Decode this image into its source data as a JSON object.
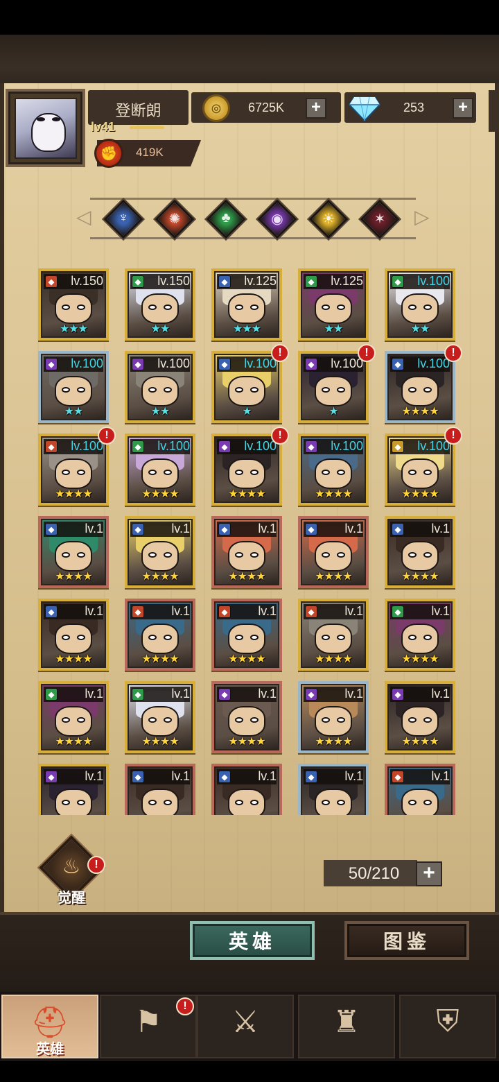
{
  "player": {
    "name": "登断朗",
    "level": "lv41",
    "power": "419K"
  },
  "currency": {
    "gold": "6725K",
    "gems": "253"
  },
  "filters": [
    {
      "name": "element-1",
      "color": "#3a62b0",
      "icon": "rune-icon"
    },
    {
      "name": "element-2",
      "color": "#c2472a",
      "icon": "sun-gear-icon"
    },
    {
      "name": "element-3",
      "color": "#2f9a4a",
      "icon": "clover-icon"
    },
    {
      "name": "element-4",
      "color": "#7a3ab0",
      "icon": "eye-orb-icon"
    },
    {
      "name": "element-5",
      "color": "#e0b22a",
      "icon": "sun-eye-icon"
    },
    {
      "name": "element-6",
      "color": "#6a1f2a",
      "icon": "dark-sigil-icon"
    }
  ],
  "heroes": [
    {
      "level": "lv.150",
      "stars": 3,
      "star_color": "teal",
      "tier": "gold",
      "level_color": "white",
      "class_color": "#c2472a",
      "hair": "#3a3028",
      "alert": false
    },
    {
      "level": "lv.150",
      "stars": 2,
      "star_color": "teal",
      "tier": "gold",
      "level_color": "white",
      "class_color": "#2f9a4a",
      "hair": "#dfe2ee",
      "alert": false
    },
    {
      "level": "lv.125",
      "stars": 3,
      "star_color": "teal",
      "tier": "gold",
      "level_color": "white",
      "class_color": "#3a62b0",
      "hair": "#e6d9c2",
      "alert": false
    },
    {
      "level": "lv.125",
      "stars": 2,
      "star_color": "teal",
      "tier": "gold",
      "level_color": "white",
      "class_color": "#2f9a4a",
      "hair": "#7a3a6a",
      "alert": false
    },
    {
      "level": "lv.100",
      "stars": 2,
      "star_color": "teal",
      "tier": "gold",
      "level_color": "cyan",
      "class_color": "#2f9a4a",
      "hair": "#e8e8ee",
      "alert": false
    },
    {
      "level": "lv.100",
      "stars": 2,
      "star_color": "teal",
      "tier": "blue",
      "level_color": "cyan",
      "class_color": "#7a3ab0",
      "hair": "#6e6a66",
      "alert": false
    },
    {
      "level": "lv.100",
      "stars": 2,
      "star_color": "teal",
      "tier": "gold",
      "level_color": "white",
      "class_color": "#7a3ab0",
      "hair": "#8a8478",
      "alert": false
    },
    {
      "level": "lv.100",
      "stars": 1,
      "star_color": "teal",
      "tier": "gold",
      "level_color": "cyan",
      "class_color": "#3a62b0",
      "hair": "#e9cf6a",
      "alert": true
    },
    {
      "level": "lv.100",
      "stars": 1,
      "star_color": "teal",
      "tier": "gold",
      "level_color": "white",
      "class_color": "#7a3ab0",
      "hair": "#2a2230",
      "alert": true
    },
    {
      "level": "lv.100",
      "stars": 4,
      "star_color": "gold",
      "tier": "blue",
      "level_color": "cyan",
      "class_color": "#3a62b0",
      "hair": "#2a2424",
      "alert": true
    },
    {
      "level": "lv.100",
      "stars": 4,
      "star_color": "gold",
      "tier": "gold",
      "level_color": "cyan",
      "class_color": "#c2472a",
      "hair": "#9a9288",
      "alert": true
    },
    {
      "level": "lv.100",
      "stars": 4,
      "star_color": "gold",
      "tier": "gold",
      "level_color": "cyan",
      "class_color": "#2f9a4a",
      "hair": "#c8a8d8",
      "alert": false
    },
    {
      "level": "lv.100",
      "stars": 4,
      "star_color": "gold",
      "tier": "gold",
      "level_color": "cyan",
      "class_color": "#7a3ab0",
      "hair": "#2c2424",
      "alert": true
    },
    {
      "level": "lv.100",
      "stars": 4,
      "star_color": "gold",
      "tier": "gold",
      "level_color": "cyan",
      "class_color": "#7a3ab0",
      "hair": "#4a6a8a",
      "alert": false
    },
    {
      "level": "lv.100",
      "stars": 4,
      "star_color": "gold",
      "tier": "gold",
      "level_color": "cyan",
      "class_color": "#c89a2a",
      "hair": "#efd98a",
      "alert": true
    },
    {
      "level": "lv.1",
      "stars": 4,
      "star_color": "gold",
      "tier": "red",
      "level_color": "white",
      "class_color": "#3a62b0",
      "hair": "#2f8a6a",
      "alert": false
    },
    {
      "level": "lv.1",
      "stars": 4,
      "star_color": "gold",
      "tier": "gold",
      "level_color": "white",
      "class_color": "#3a62b0",
      "hair": "#e9cf6a",
      "alert": false
    },
    {
      "level": "lv.1",
      "stars": 4,
      "star_color": "gold",
      "tier": "red",
      "level_color": "white",
      "class_color": "#3a62b0",
      "hair": "#d46a4a",
      "alert": false
    },
    {
      "level": "lv.1",
      "stars": 4,
      "star_color": "gold",
      "tier": "red",
      "level_color": "white",
      "class_color": "#3a62b0",
      "hair": "#d46a4a",
      "alert": false
    },
    {
      "level": "lv.1",
      "stars": 4,
      "star_color": "gold",
      "tier": "gold",
      "level_color": "white",
      "class_color": "#3a62b0",
      "hair": "#3a2a24",
      "alert": false
    },
    {
      "level": "lv.1",
      "stars": 4,
      "star_color": "gold",
      "tier": "gold",
      "level_color": "white",
      "class_color": "#3a62b0",
      "hair": "#3a2a24",
      "alert": false
    },
    {
      "level": "lv.1",
      "stars": 4,
      "star_color": "gold",
      "tier": "red",
      "level_color": "white",
      "class_color": "#c2472a",
      "hair": "#3a6a8a",
      "alert": false
    },
    {
      "level": "lv.1",
      "stars": 4,
      "star_color": "gold",
      "tier": "red",
      "level_color": "white",
      "class_color": "#c2472a",
      "hair": "#3a6a8a",
      "alert": false
    },
    {
      "level": "lv.1",
      "stars": 4,
      "star_color": "gold",
      "tier": "gold",
      "level_color": "white",
      "class_color": "#c2472a",
      "hair": "#8a8478",
      "alert": false
    },
    {
      "level": "lv.1",
      "stars": 4,
      "star_color": "gold",
      "tier": "gold",
      "level_color": "white",
      "class_color": "#2f9a4a",
      "hair": "#7a3a6a",
      "alert": false
    },
    {
      "level": "lv.1",
      "stars": 4,
      "star_color": "gold",
      "tier": "gold",
      "level_color": "white",
      "class_color": "#2f9a4a",
      "hair": "#7a3a6a",
      "alert": false
    },
    {
      "level": "lv.1",
      "stars": 4,
      "star_color": "gold",
      "tier": "gold",
      "level_color": "white",
      "class_color": "#2f9a4a",
      "hair": "#dfe2ee",
      "alert": false
    },
    {
      "level": "lv.1",
      "stars": 4,
      "star_color": "gold",
      "tier": "red",
      "level_color": "white",
      "class_color": "#7a3ab0",
      "hair": "#6a5a50",
      "alert": false
    },
    {
      "level": "lv.1",
      "stars": 4,
      "star_color": "gold",
      "tier": "blue",
      "level_color": "white",
      "class_color": "#7a3ab0",
      "hair": "#b88a5a",
      "alert": false
    },
    {
      "level": "lv.1",
      "stars": 4,
      "star_color": "gold",
      "tier": "gold",
      "level_color": "white",
      "class_color": "#7a3ab0",
      "hair": "#2c2424",
      "alert": false
    },
    {
      "level": "lv.1",
      "stars": 0,
      "star_color": "gold",
      "tier": "gold",
      "level_color": "white",
      "class_color": "#7a3ab0",
      "hair": "#2a2230",
      "alert": false
    },
    {
      "level": "lv.1",
      "stars": 0,
      "star_color": "gold",
      "tier": "red",
      "level_color": "white",
      "class_color": "#3a62b0",
      "hair": "#3a2a24",
      "alert": false
    },
    {
      "level": "lv.1",
      "stars": 0,
      "star_color": "gold",
      "tier": "red",
      "level_color": "white",
      "class_color": "#3a62b0",
      "hair": "#3a2a24",
      "alert": false
    },
    {
      "level": "lv.1",
      "stars": 0,
      "star_color": "gold",
      "tier": "blue",
      "level_color": "white",
      "class_color": "#3a62b0",
      "hair": "#2a2424",
      "alert": false
    },
    {
      "level": "lv.1",
      "stars": 0,
      "star_color": "gold",
      "tier": "red",
      "level_color": "white",
      "class_color": "#c2472a",
      "hair": "#3a6a8a",
      "alert": false
    }
  ],
  "awaken": {
    "label": "觉醒"
  },
  "roster": {
    "capacity": "50/210"
  },
  "tabs": {
    "heroes": "英雄",
    "codex": "图鉴"
  },
  "nav": [
    {
      "name": "heroes",
      "label": "英雄",
      "icon": "knight-helmet-icon",
      "active": true,
      "alert": false
    },
    {
      "name": "adventure",
      "label": "",
      "icon": "flag-wheel-icon",
      "active": false,
      "alert": true
    },
    {
      "name": "battle",
      "label": "",
      "icon": "crossed-swords-icon",
      "active": false,
      "alert": false
    },
    {
      "name": "tower",
      "label": "",
      "icon": "castle-tower-icon",
      "active": false,
      "alert": false
    },
    {
      "name": "guild",
      "label": "",
      "icon": "handshake-crest-icon",
      "active": false,
      "alert": false
    }
  ]
}
